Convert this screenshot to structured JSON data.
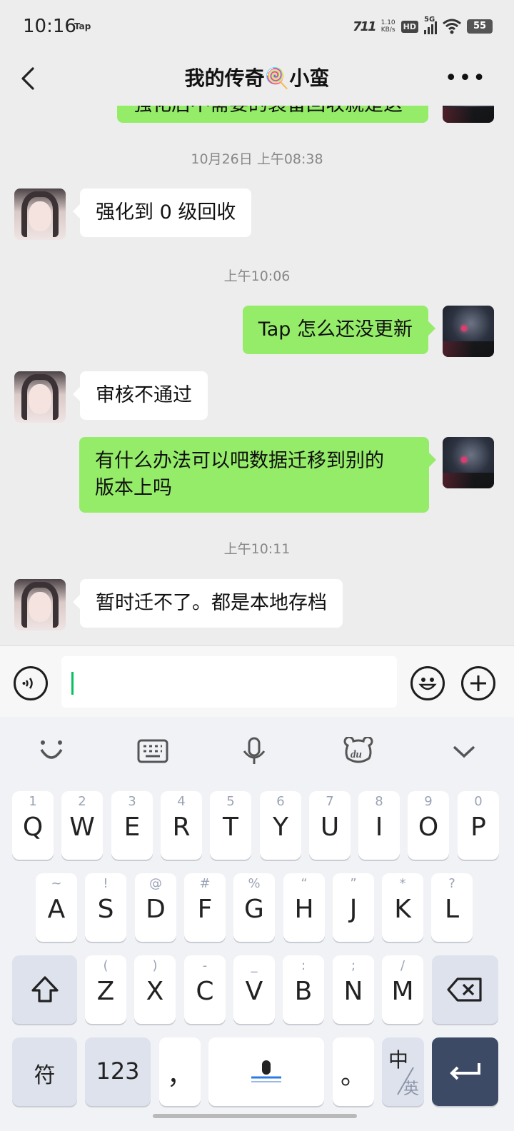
{
  "status_bar": {
    "time": "10:16",
    "app_badge": "Tap",
    "carrier": "711",
    "speed_value": "1.10",
    "speed_unit": "KB/s",
    "hd": "HD",
    "network": "5G",
    "battery": "55"
  },
  "header": {
    "title": "我的传奇🍭小蛮"
  },
  "messages": {
    "m0": {
      "text": "强化后不需要的装备回收就是这"
    },
    "t1": {
      "text": "10月26日 上午08:38"
    },
    "m1": {
      "text": "强化到 0 级回收"
    },
    "t2": {
      "text": "上午10:06"
    },
    "m2": {
      "text": "Tap 怎么还没更新"
    },
    "m3": {
      "text": "审核不通过"
    },
    "m4": {
      "line1": "有什么办法可以吧数据迁移到别的",
      "line2": "版本上吗"
    },
    "t3": {
      "text": "上午10:11"
    },
    "m5": {
      "text": "暂时迁不了。都是本地存档"
    }
  },
  "input": {
    "value": ""
  },
  "keyboard": {
    "row1": [
      {
        "hint": "1",
        "label": "Q"
      },
      {
        "hint": "2",
        "label": "W"
      },
      {
        "hint": "3",
        "label": "E"
      },
      {
        "hint": "4",
        "label": "R"
      },
      {
        "hint": "5",
        "label": "T"
      },
      {
        "hint": "6",
        "label": "Y"
      },
      {
        "hint": "7",
        "label": "U"
      },
      {
        "hint": "8",
        "label": "I"
      },
      {
        "hint": "9",
        "label": "O"
      },
      {
        "hint": "0",
        "label": "P"
      }
    ],
    "row2": [
      {
        "hint": "~",
        "label": "A"
      },
      {
        "hint": "!",
        "label": "S"
      },
      {
        "hint": "@",
        "label": "D"
      },
      {
        "hint": "#",
        "label": "F"
      },
      {
        "hint": "%",
        "label": "G"
      },
      {
        "hint": "“",
        "label": "H"
      },
      {
        "hint": "”",
        "label": "J"
      },
      {
        "hint": "*",
        "label": "K"
      },
      {
        "hint": "?",
        "label": "L"
      }
    ],
    "row3": [
      {
        "hint": "(",
        "label": "Z"
      },
      {
        "hint": ")",
        "label": "X"
      },
      {
        "hint": "-",
        "label": "C"
      },
      {
        "hint": "_",
        "label": "V"
      },
      {
        "hint": ":",
        "label": "B"
      },
      {
        "hint": ";",
        "label": "N"
      },
      {
        "hint": "/",
        "label": "M"
      }
    ],
    "symbols": "符",
    "numbers": "123",
    "comma": "，",
    "period": "。",
    "lang_main": "中",
    "lang_alt": "英"
  },
  "colors": {
    "outgoing_bubble": "#95ec69",
    "incoming_bubble": "#ffffff",
    "caret": "#07c160",
    "enter_key": "#3c4a65"
  }
}
